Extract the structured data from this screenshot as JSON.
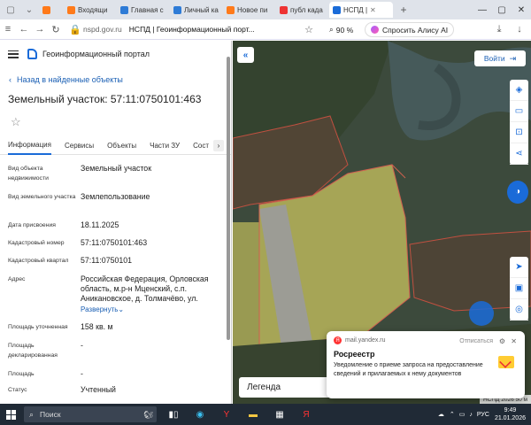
{
  "browser": {
    "tabs": [
      {
        "label": "",
        "color": "#ff7a1a"
      },
      {
        "label": "Входящи",
        "color": "#ff7a1a"
      },
      {
        "label": "Главная с",
        "color": "#2e7bd6"
      },
      {
        "label": "Личный ка",
        "color": "#2e7bd6"
      },
      {
        "label": "Новое пи",
        "color": "#ff7a1a"
      },
      {
        "label": "публ када",
        "color": "#e33"
      },
      {
        "label": "НСПД |",
        "color": "#1a6bd8"
      }
    ],
    "url_domain": "nspd.gov.ru",
    "page_title": "НСПД | Геоинформационный порт...",
    "zoom": "90 %",
    "alice_label": "Спросить Алису AI"
  },
  "panel": {
    "portal_name": "Геоинформационный портал",
    "back_link": "Назад в найденные объекты",
    "title": "Земельный участок: 57:11:0750101:463",
    "tabs": [
      "Информация",
      "Сервисы",
      "Объекты",
      "Части ЗУ",
      "Сост"
    ],
    "properties": [
      {
        "key": "Вид объекта недвижимости",
        "value": "Земельный участок"
      },
      {
        "key": "Вид земельного участка",
        "value": "Землепользование"
      },
      {
        "key": "Дата присвоения",
        "value": "18.11.2025"
      },
      {
        "key": "Кадастровый номер",
        "value": "57:11:0750101:463"
      },
      {
        "key": "Кадастровый квартал",
        "value": "57:11:0750101"
      },
      {
        "key": "Адрес",
        "value": "Российская Федерация, Орловская область, м.р-н Мценский, с.п. Аникановское, д. Толмачёво, ул.",
        "link": "Развернуть"
      },
      {
        "key": "Площадь уточненная",
        "value": "158 кв. м"
      },
      {
        "key": "Площадь декларированная",
        "value": "-"
      },
      {
        "key": "Площадь",
        "value": "-"
      },
      {
        "key": "Статус",
        "value": "Учтенный"
      }
    ]
  },
  "map": {
    "login_label": "Войти",
    "legend_label": "Легенда",
    "scale_text": "НСПД 2026   50 м"
  },
  "notification": {
    "source": "mail.yandex.ru",
    "unsubscribe": "Отписаться",
    "sender": "Росреестр",
    "body": "Уведомление о приеме запроса на предоставление сведений и прилагаемых к нему документов"
  },
  "taskbar": {
    "search_placeholder": "Поиск",
    "lang": "РУС",
    "time": "9:49",
    "date": "21.01.2026"
  }
}
